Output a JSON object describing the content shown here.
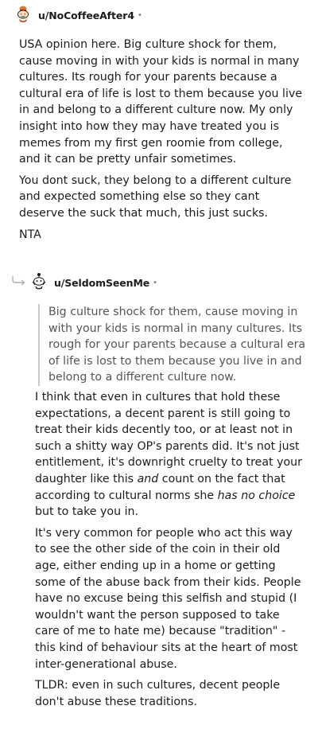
{
  "comment1": {
    "username": "u/NoCoffeeAfter4",
    "separator": "•",
    "paragraphs": [
      "USA opinion here. Big culture shock for them, cause moving in with your kids is normal in many cultures. Its rough for your parents because a cultural era of life is lost to them because you live in and belong to a different culture now. My only insight into how they may have treated you is memes from my first gen roomie from college, and it can be pretty unfair sometimes.",
      "You dont suck, they belong to a different culture and expected something else so they cant deserve the suck that much, this just sucks.",
      "NTA"
    ]
  },
  "comment2": {
    "username": "u/SeldomSeenMe",
    "separator": "•",
    "quote": "Big culture shock for them, cause moving in with your kids is normal in many cultures. Its rough for your parents because a cultural era of life is lost to them because you live in and belong to a different culture now.",
    "p1": {
      "a": "I think that even in cultures that hold these expectations, a decent parent is still going to treat their kids decently too, or at least not in such a shitty way OP's parents did. It's not just entitlement, it's downright cruelty to treat your daughter like this ",
      "em1": "and",
      "b": " count on the fact that according to cultural norms she ",
      "em2": "has no choice",
      "c": " but to take you in."
    },
    "p2": "It's very common for people who act this way to see the other side of the coin in their old age, either ending up in a home or getting some of the abuse back from their kids. People have no excuse being this selfish and stupid (I wouldn't want the person supposed to take care of me to hate me) because \"tradition\" - this kind of behaviour sits at the heart of most inter-generational abuse.",
    "p3": "TLDR: even in such cultures, decent people don't abuse these traditions."
  },
  "colors": {
    "text": "#1c1c1c",
    "quote_text": "#555555",
    "quote_bar": "#c9c9c9",
    "meta": "#7c7c7c",
    "avatar1_accent": "#e8702a",
    "avatar2_accent": "#1a1a1a"
  },
  "icons": {
    "avatar1": "snoo-avatar-icon",
    "avatar2": "snoo-avatar-icon",
    "reply_arrow": "reply-arrow-icon"
  }
}
